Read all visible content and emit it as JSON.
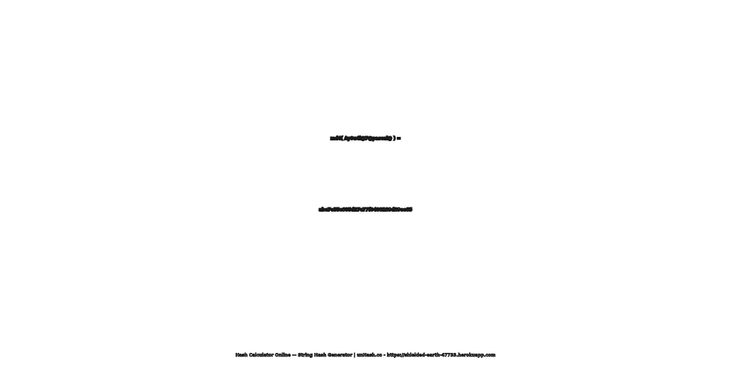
{
  "expression": "md4( Ay0u4l@7@pascal@ ) =",
  "hash": "abe7e55c605d27c77f0408189d89ee85",
  "footer": "Hash Calculator Online — String Hash Generator | unHash.co - https://shielded-earth-47733.herokuapp.com",
  "colors": {
    "background": "#ffffff",
    "text_fill": "#ffffff",
    "text_outline": "#1a1a1a"
  }
}
